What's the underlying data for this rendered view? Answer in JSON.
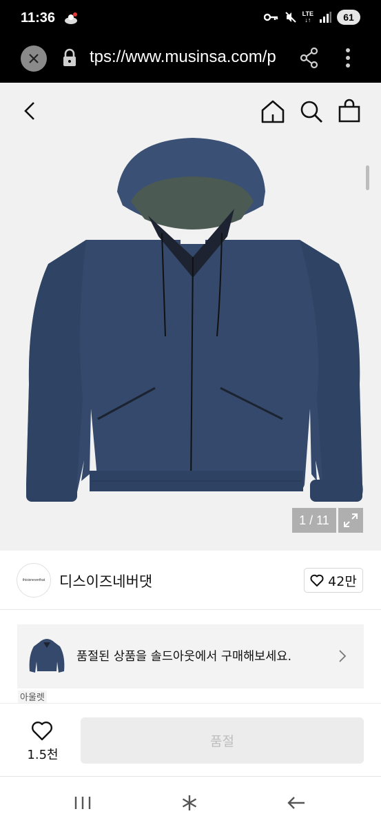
{
  "status_bar": {
    "time": "11:36",
    "network": "LTE",
    "battery": "61"
  },
  "browser": {
    "url": "tps://www.musinsa.com/p"
  },
  "product": {
    "image_counter": "1 / 11"
  },
  "brand": {
    "logo_text": "thisisneverthat",
    "name": "디스이즈네버댓",
    "likes": "42만"
  },
  "soldout_banner": {
    "text": "품절된 상품을 솔드아웃에서 구매해보세요."
  },
  "tags": {
    "outlet": "아울렛"
  },
  "bottom_bar": {
    "wishlist_count": "1.5천",
    "buy_label": "품절"
  },
  "colors": {
    "jacket": "#34496b",
    "accent_bg": "#f1f1f1",
    "disabled_button": "#ececec"
  },
  "icons": [
    "close-icon",
    "lock-icon",
    "share-icon",
    "more-vert-icon",
    "back-arrow-icon",
    "home-icon",
    "search-icon",
    "shopping-bag-icon",
    "expand-icon",
    "heart-icon",
    "chevron-right-icon",
    "recent-apps-icon",
    "home-nav-icon",
    "back-nav-icon"
  ]
}
